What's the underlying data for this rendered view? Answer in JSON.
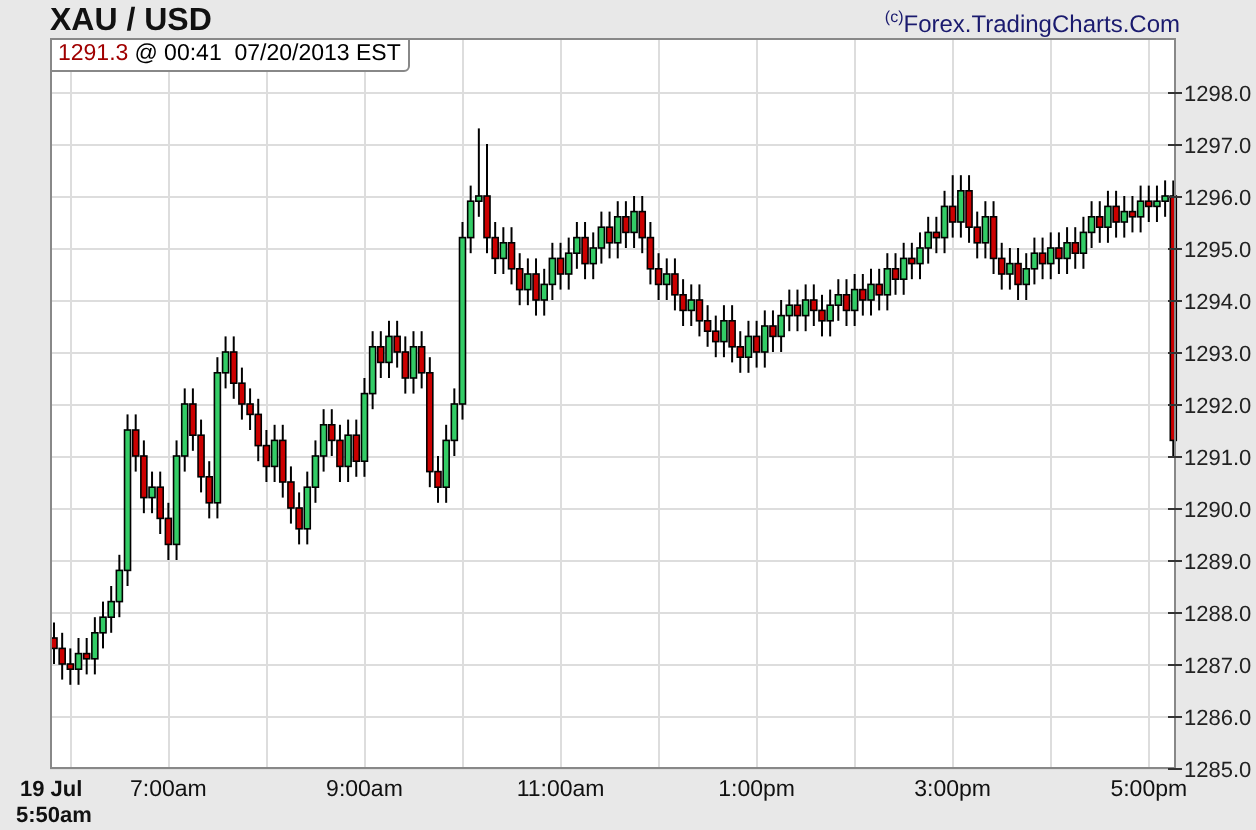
{
  "header": {
    "credit": "$^{(c)}$Forex.TradingCharts.Com"
  },
  "readout": {
    "price": "1291.3",
    "timestamp": "@ 00:41  07/20/2013 EST"
  },
  "chart": {
    "x_start": {
      "date": "19 Jul",
      "time": "5:50am"
    },
    "chart_data": {
      "type": "candlestick",
      "title": "XAU / USD",
      "grid": true,
      "ylim": [
        1285,
        1299
      ],
      "yticks": [
        {
          "value": 1285,
          "label": "1285.0"
        },
        {
          "value": 1286,
          "label": "1286.0"
        },
        {
          "value": 1287,
          "label": "1287.0"
        },
        {
          "value": 1288,
          "label": "1288.0"
        },
        {
          "value": 1289,
          "label": "1289.0"
        },
        {
          "value": 1290,
          "label": "1290.0"
        },
        {
          "value": 1291,
          "label": "1291.0"
        },
        {
          "value": 1292,
          "label": "1292.0"
        },
        {
          "value": 1293,
          "label": "1293.0"
        },
        {
          "value": 1294,
          "label": "1294.0"
        },
        {
          "value": 1295,
          "label": "1295.0"
        },
        {
          "value": 1296,
          "label": "1296.0"
        },
        {
          "value": 1297,
          "label": "1297.0"
        },
        {
          "value": 1298,
          "label": "1298.0"
        }
      ],
      "categories": [
        null,
        null,
        null,
        null,
        null,
        null,
        null,
        null,
        null,
        null,
        null,
        null,
        null,
        null,
        "7:00am",
        null,
        null,
        null,
        null,
        null,
        null,
        null,
        null,
        null,
        null,
        null,
        null,
        null,
        null,
        null,
        null,
        null,
        null,
        null,
        null,
        null,
        null,
        null,
        "9:00am",
        null,
        null,
        null,
        null,
        null,
        null,
        null,
        null,
        null,
        null,
        null,
        null,
        null,
        null,
        null,
        null,
        null,
        null,
        null,
        null,
        null,
        null,
        null,
        "11:00am",
        null,
        null,
        null,
        null,
        null,
        null,
        null,
        null,
        null,
        null,
        null,
        null,
        null,
        null,
        null,
        null,
        null,
        null,
        null,
        null,
        null,
        null,
        null,
        "1:00pm",
        null,
        null,
        null,
        null,
        null,
        null,
        null,
        null,
        null,
        null,
        null,
        null,
        null,
        null,
        null,
        null,
        null,
        null,
        null,
        null,
        null,
        null,
        null,
        "3:00pm",
        null,
        null,
        null,
        null,
        null,
        null,
        null,
        null,
        null,
        null,
        null,
        null,
        null,
        null,
        null,
        null,
        null,
        null,
        null,
        null,
        null,
        null,
        null,
        "5:00pm",
        null,
        null,
        null
      ],
      "ohlc": [
        [
          1287.5,
          1287.8,
          1287.0,
          1287.3
        ],
        [
          1287.3,
          1287.6,
          1286.7,
          1287.0
        ],
        [
          1287.0,
          1287.3,
          1286.6,
          1286.9
        ],
        [
          1286.9,
          1287.5,
          1286.6,
          1287.2
        ],
        [
          1287.2,
          1287.5,
          1286.8,
          1287.1
        ],
        [
          1287.1,
          1287.9,
          1286.8,
          1287.6
        ],
        [
          1287.6,
          1288.2,
          1287.3,
          1287.9
        ],
        [
          1287.9,
          1288.5,
          1287.6,
          1288.2
        ],
        [
          1288.2,
          1289.1,
          1287.9,
          1288.8
        ],
        [
          1288.8,
          1291.8,
          1288.5,
          1291.5
        ],
        [
          1291.5,
          1291.8,
          1290.7,
          1291.0
        ],
        [
          1291.0,
          1291.3,
          1289.9,
          1290.2
        ],
        [
          1290.2,
          1290.7,
          1289.9,
          1290.4
        ],
        [
          1290.4,
          1290.7,
          1289.5,
          1289.8
        ],
        [
          1289.8,
          1290.1,
          1289.0,
          1289.3
        ],
        [
          1289.3,
          1291.3,
          1289.0,
          1291.0
        ],
        [
          1291.0,
          1292.3,
          1290.7,
          1292.0
        ],
        [
          1292.0,
          1292.3,
          1291.1,
          1291.4
        ],
        [
          1291.4,
          1291.7,
          1290.3,
          1290.6
        ],
        [
          1290.6,
          1290.9,
          1289.8,
          1290.1
        ],
        [
          1290.1,
          1292.9,
          1289.8,
          1292.6
        ],
        [
          1292.6,
          1293.3,
          1292.3,
          1293.0
        ],
        [
          1293.0,
          1293.3,
          1292.1,
          1292.4
        ],
        [
          1292.4,
          1292.7,
          1291.7,
          1292.0
        ],
        [
          1292.0,
          1292.3,
          1291.5,
          1291.8
        ],
        [
          1291.8,
          1292.1,
          1290.9,
          1291.2
        ],
        [
          1291.2,
          1291.5,
          1290.5,
          1290.8
        ],
        [
          1290.8,
          1291.6,
          1290.5,
          1291.3
        ],
        [
          1291.3,
          1291.6,
          1290.2,
          1290.5
        ],
        [
          1290.5,
          1290.8,
          1289.7,
          1290.0
        ],
        [
          1290.0,
          1290.3,
          1289.3,
          1289.6
        ],
        [
          1289.6,
          1290.7,
          1289.3,
          1290.4
        ],
        [
          1290.4,
          1291.3,
          1290.1,
          1291.0
        ],
        [
          1291.0,
          1291.9,
          1290.7,
          1291.6
        ],
        [
          1291.6,
          1291.9,
          1291.0,
          1291.3
        ],
        [
          1291.3,
          1291.6,
          1290.5,
          1290.8
        ],
        [
          1290.8,
          1291.7,
          1290.5,
          1291.4
        ],
        [
          1291.4,
          1291.7,
          1290.6,
          1290.9
        ],
        [
          1290.9,
          1292.5,
          1290.6,
          1292.2
        ],
        [
          1292.2,
          1293.4,
          1291.9,
          1293.1
        ],
        [
          1293.1,
          1293.4,
          1292.5,
          1292.8
        ],
        [
          1292.8,
          1293.6,
          1292.5,
          1293.3
        ],
        [
          1293.3,
          1293.6,
          1292.7,
          1293.0
        ],
        [
          1293.0,
          1293.3,
          1292.2,
          1292.5
        ],
        [
          1292.5,
          1293.4,
          1292.2,
          1293.1
        ],
        [
          1293.1,
          1293.4,
          1292.3,
          1292.6
        ],
        [
          1292.6,
          1292.9,
          1290.4,
          1290.7
        ],
        [
          1290.7,
          1291.0,
          1290.1,
          1290.4
        ],
        [
          1290.4,
          1291.6,
          1290.1,
          1291.3
        ],
        [
          1291.3,
          1292.3,
          1291.0,
          1292.0
        ],
        [
          1292.0,
          1295.5,
          1291.7,
          1295.2
        ],
        [
          1295.2,
          1296.2,
          1294.9,
          1295.9
        ],
        [
          1295.9,
          1297.3,
          1295.6,
          1296.0
        ],
        [
          1296.0,
          1297.0,
          1294.9,
          1295.2
        ],
        [
          1295.2,
          1295.5,
          1294.5,
          1294.8
        ],
        [
          1294.8,
          1295.4,
          1294.5,
          1295.1
        ],
        [
          1295.1,
          1295.4,
          1294.3,
          1294.6
        ],
        [
          1294.6,
          1294.9,
          1293.9,
          1294.2
        ],
        [
          1294.2,
          1294.8,
          1293.9,
          1294.5
        ],
        [
          1294.5,
          1294.8,
          1293.7,
          1294.0
        ],
        [
          1294.0,
          1294.6,
          1293.7,
          1294.3
        ],
        [
          1294.3,
          1295.1,
          1294.0,
          1294.8
        ],
        [
          1294.8,
          1295.1,
          1294.2,
          1294.5
        ],
        [
          1294.5,
          1295.2,
          1294.2,
          1294.9
        ],
        [
          1294.9,
          1295.5,
          1294.6,
          1295.2
        ],
        [
          1295.2,
          1295.5,
          1294.4,
          1294.7
        ],
        [
          1294.7,
          1295.3,
          1294.4,
          1295.0
        ],
        [
          1295.0,
          1295.7,
          1294.7,
          1295.4
        ],
        [
          1295.4,
          1295.7,
          1294.8,
          1295.1
        ],
        [
          1295.1,
          1295.9,
          1294.8,
          1295.6
        ],
        [
          1295.6,
          1295.9,
          1295.0,
          1295.3
        ],
        [
          1295.3,
          1296.0,
          1295.0,
          1295.7
        ],
        [
          1295.7,
          1296.0,
          1294.9,
          1295.2
        ],
        [
          1295.2,
          1295.5,
          1294.3,
          1294.6
        ],
        [
          1294.6,
          1294.9,
          1294.0,
          1294.3
        ],
        [
          1294.3,
          1294.8,
          1294.0,
          1294.5
        ],
        [
          1294.5,
          1294.8,
          1293.8,
          1294.1
        ],
        [
          1294.1,
          1294.4,
          1293.5,
          1293.8
        ],
        [
          1293.8,
          1294.3,
          1293.5,
          1294.0
        ],
        [
          1294.0,
          1294.3,
          1293.3,
          1293.6
        ],
        [
          1293.6,
          1293.9,
          1293.1,
          1293.4
        ],
        [
          1293.4,
          1293.7,
          1292.9,
          1293.2
        ],
        [
          1293.2,
          1293.9,
          1292.9,
          1293.6
        ],
        [
          1293.6,
          1293.9,
          1292.8,
          1293.1
        ],
        [
          1293.1,
          1293.4,
          1292.6,
          1292.9
        ],
        [
          1292.9,
          1293.6,
          1292.6,
          1293.3
        ],
        [
          1293.3,
          1293.6,
          1292.7,
          1293.0
        ],
        [
          1293.0,
          1293.8,
          1292.7,
          1293.5
        ],
        [
          1293.5,
          1293.8,
          1293.0,
          1293.3
        ],
        [
          1293.3,
          1294.0,
          1293.0,
          1293.7
        ],
        [
          1293.7,
          1294.2,
          1293.4,
          1293.9
        ],
        [
          1293.9,
          1294.2,
          1293.4,
          1293.7
        ],
        [
          1293.7,
          1294.3,
          1293.4,
          1294.0
        ],
        [
          1294.0,
          1294.3,
          1293.5,
          1293.8
        ],
        [
          1293.8,
          1294.1,
          1293.3,
          1293.6
        ],
        [
          1293.6,
          1294.2,
          1293.3,
          1293.9
        ],
        [
          1293.9,
          1294.4,
          1293.6,
          1294.1
        ],
        [
          1294.1,
          1294.4,
          1293.5,
          1293.8
        ],
        [
          1293.8,
          1294.5,
          1293.5,
          1294.2
        ],
        [
          1294.2,
          1294.5,
          1293.7,
          1294.0
        ],
        [
          1294.0,
          1294.6,
          1293.7,
          1294.3
        ],
        [
          1294.3,
          1294.6,
          1293.8,
          1294.1
        ],
        [
          1294.1,
          1294.9,
          1293.8,
          1294.6
        ],
        [
          1294.6,
          1294.9,
          1294.1,
          1294.4
        ],
        [
          1294.4,
          1295.1,
          1294.1,
          1294.8
        ],
        [
          1294.8,
          1295.1,
          1294.4,
          1294.7
        ],
        [
          1294.7,
          1295.3,
          1294.4,
          1295.0
        ],
        [
          1295.0,
          1295.6,
          1294.7,
          1295.3
        ],
        [
          1295.3,
          1295.6,
          1294.9,
          1295.2
        ],
        [
          1295.2,
          1296.1,
          1294.9,
          1295.8
        ],
        [
          1295.8,
          1296.4,
          1295.2,
          1295.5
        ],
        [
          1295.5,
          1296.4,
          1295.2,
          1296.1
        ],
        [
          1296.1,
          1296.4,
          1295.1,
          1295.4
        ],
        [
          1295.4,
          1295.7,
          1294.8,
          1295.1
        ],
        [
          1295.1,
          1295.9,
          1294.8,
          1295.6
        ],
        [
          1295.6,
          1295.9,
          1294.5,
          1294.8
        ],
        [
          1294.8,
          1295.1,
          1294.2,
          1294.5
        ],
        [
          1294.5,
          1295.0,
          1294.2,
          1294.7
        ],
        [
          1294.7,
          1295.0,
          1294.0,
          1294.3
        ],
        [
          1294.3,
          1294.9,
          1294.0,
          1294.6
        ],
        [
          1294.6,
          1295.2,
          1294.3,
          1294.9
        ],
        [
          1294.9,
          1295.2,
          1294.4,
          1294.7
        ],
        [
          1294.7,
          1295.3,
          1294.4,
          1295.0
        ],
        [
          1295.0,
          1295.3,
          1294.5,
          1294.8
        ],
        [
          1294.8,
          1295.4,
          1294.5,
          1295.1
        ],
        [
          1295.1,
          1295.4,
          1294.6,
          1294.9
        ],
        [
          1294.9,
          1295.6,
          1294.6,
          1295.3
        ],
        [
          1295.3,
          1295.9,
          1295.0,
          1295.6
        ],
        [
          1295.6,
          1295.9,
          1295.1,
          1295.4
        ],
        [
          1295.4,
          1296.1,
          1295.1,
          1295.8
        ],
        [
          1295.8,
          1296.1,
          1295.2,
          1295.5
        ],
        [
          1295.5,
          1296.0,
          1295.2,
          1295.7
        ],
        [
          1295.7,
          1296.0,
          1295.3,
          1295.6
        ],
        [
          1295.6,
          1296.2,
          1295.3,
          1295.9
        ],
        [
          1295.9,
          1296.2,
          1295.5,
          1295.8
        ],
        [
          1295.8,
          1296.2,
          1295.5,
          1295.9
        ],
        [
          1295.9,
          1296.3,
          1295.6,
          1296.0
        ],
        [
          1296.0,
          1296.3,
          1291.0,
          1291.3
        ]
      ]
    }
  }
}
